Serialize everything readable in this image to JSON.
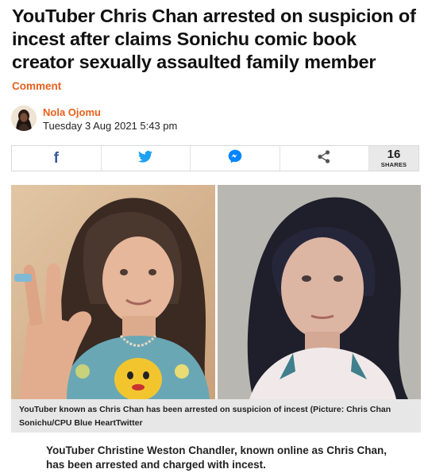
{
  "article": {
    "headline": "YouTuber Chris Chan arrested on suspicion of incest after claims Sonichu comic book creator sexually assaulted family member",
    "category": "Comment",
    "author": "Nola Ojomu",
    "date": "Tuesday 3 Aug 2021 5:43 pm"
  },
  "share": {
    "buttons": [
      {
        "name": "facebook",
        "icon": "facebook-icon",
        "glyph": "f",
        "color": "#3b5998"
      },
      {
        "name": "twitter",
        "icon": "twitter-icon",
        "color": "#1da1f2"
      },
      {
        "name": "messenger",
        "icon": "messenger-icon",
        "color": "#0084ff"
      },
      {
        "name": "share",
        "icon": "share-icon",
        "color": "#555555"
      }
    ],
    "count": "16",
    "count_label": "SHARES"
  },
  "figure": {
    "caption": "YouTuber known as Chris Chan has been arrested on suspicion of incest (Picture: Chris Chan Sonichu/CPU Blue HeartTwitter"
  },
  "body": {
    "lead": "YouTuber Christine Weston Chandler, known online as Chris Chan, has been arrested and charged with incest."
  },
  "colors": {
    "accent": "#e8601d",
    "caption_bg": "#e7e7e7",
    "share_count_bg": "#e9e9e9"
  }
}
